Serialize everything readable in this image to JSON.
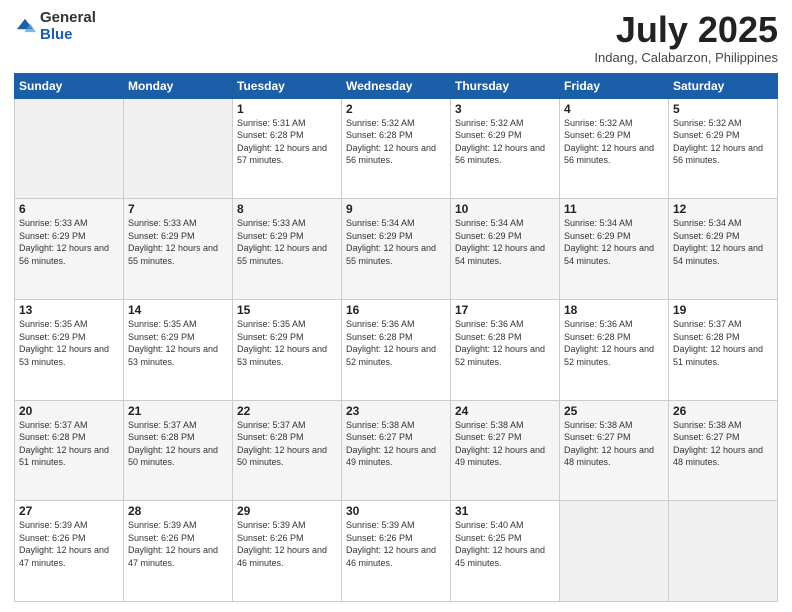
{
  "header": {
    "logo_general": "General",
    "logo_blue": "Blue",
    "month_title": "July 2025",
    "location": "Indang, Calabarzon, Philippines"
  },
  "days_of_week": [
    "Sunday",
    "Monday",
    "Tuesday",
    "Wednesday",
    "Thursday",
    "Friday",
    "Saturday"
  ],
  "weeks": [
    [
      {
        "day": "",
        "empty": true
      },
      {
        "day": "",
        "empty": true
      },
      {
        "day": "1",
        "sunrise": "5:31 AM",
        "sunset": "6:28 PM",
        "daylight": "12 hours and 57 minutes."
      },
      {
        "day": "2",
        "sunrise": "5:32 AM",
        "sunset": "6:28 PM",
        "daylight": "12 hours and 56 minutes."
      },
      {
        "day": "3",
        "sunrise": "5:32 AM",
        "sunset": "6:29 PM",
        "daylight": "12 hours and 56 minutes."
      },
      {
        "day": "4",
        "sunrise": "5:32 AM",
        "sunset": "6:29 PM",
        "daylight": "12 hours and 56 minutes."
      },
      {
        "day": "5",
        "sunrise": "5:32 AM",
        "sunset": "6:29 PM",
        "daylight": "12 hours and 56 minutes."
      }
    ],
    [
      {
        "day": "6",
        "sunrise": "5:33 AM",
        "sunset": "6:29 PM",
        "daylight": "12 hours and 56 minutes."
      },
      {
        "day": "7",
        "sunrise": "5:33 AM",
        "sunset": "6:29 PM",
        "daylight": "12 hours and 55 minutes."
      },
      {
        "day": "8",
        "sunrise": "5:33 AM",
        "sunset": "6:29 PM",
        "daylight": "12 hours and 55 minutes."
      },
      {
        "day": "9",
        "sunrise": "5:34 AM",
        "sunset": "6:29 PM",
        "daylight": "12 hours and 55 minutes."
      },
      {
        "day": "10",
        "sunrise": "5:34 AM",
        "sunset": "6:29 PM",
        "daylight": "12 hours and 54 minutes."
      },
      {
        "day": "11",
        "sunrise": "5:34 AM",
        "sunset": "6:29 PM",
        "daylight": "12 hours and 54 minutes."
      },
      {
        "day": "12",
        "sunrise": "5:34 AM",
        "sunset": "6:29 PM",
        "daylight": "12 hours and 54 minutes."
      }
    ],
    [
      {
        "day": "13",
        "sunrise": "5:35 AM",
        "sunset": "6:29 PM",
        "daylight": "12 hours and 53 minutes."
      },
      {
        "day": "14",
        "sunrise": "5:35 AM",
        "sunset": "6:29 PM",
        "daylight": "12 hours and 53 minutes."
      },
      {
        "day": "15",
        "sunrise": "5:35 AM",
        "sunset": "6:29 PM",
        "daylight": "12 hours and 53 minutes."
      },
      {
        "day": "16",
        "sunrise": "5:36 AM",
        "sunset": "6:28 PM",
        "daylight": "12 hours and 52 minutes."
      },
      {
        "day": "17",
        "sunrise": "5:36 AM",
        "sunset": "6:28 PM",
        "daylight": "12 hours and 52 minutes."
      },
      {
        "day": "18",
        "sunrise": "5:36 AM",
        "sunset": "6:28 PM",
        "daylight": "12 hours and 52 minutes."
      },
      {
        "day": "19",
        "sunrise": "5:37 AM",
        "sunset": "6:28 PM",
        "daylight": "12 hours and 51 minutes."
      }
    ],
    [
      {
        "day": "20",
        "sunrise": "5:37 AM",
        "sunset": "6:28 PM",
        "daylight": "12 hours and 51 minutes."
      },
      {
        "day": "21",
        "sunrise": "5:37 AM",
        "sunset": "6:28 PM",
        "daylight": "12 hours and 50 minutes."
      },
      {
        "day": "22",
        "sunrise": "5:37 AM",
        "sunset": "6:28 PM",
        "daylight": "12 hours and 50 minutes."
      },
      {
        "day": "23",
        "sunrise": "5:38 AM",
        "sunset": "6:27 PM",
        "daylight": "12 hours and 49 minutes."
      },
      {
        "day": "24",
        "sunrise": "5:38 AM",
        "sunset": "6:27 PM",
        "daylight": "12 hours and 49 minutes."
      },
      {
        "day": "25",
        "sunrise": "5:38 AM",
        "sunset": "6:27 PM",
        "daylight": "12 hours and 48 minutes."
      },
      {
        "day": "26",
        "sunrise": "5:38 AM",
        "sunset": "6:27 PM",
        "daylight": "12 hours and 48 minutes."
      }
    ],
    [
      {
        "day": "27",
        "sunrise": "5:39 AM",
        "sunset": "6:26 PM",
        "daylight": "12 hours and 47 minutes."
      },
      {
        "day": "28",
        "sunrise": "5:39 AM",
        "sunset": "6:26 PM",
        "daylight": "12 hours and 47 minutes."
      },
      {
        "day": "29",
        "sunrise": "5:39 AM",
        "sunset": "6:26 PM",
        "daylight": "12 hours and 46 minutes."
      },
      {
        "day": "30",
        "sunrise": "5:39 AM",
        "sunset": "6:26 PM",
        "daylight": "12 hours and 46 minutes."
      },
      {
        "day": "31",
        "sunrise": "5:40 AM",
        "sunset": "6:25 PM",
        "daylight": "12 hours and 45 minutes."
      },
      {
        "day": "",
        "empty": true
      },
      {
        "day": "",
        "empty": true
      }
    ]
  ],
  "labels": {
    "sunrise_prefix": "Sunrise: ",
    "sunset_prefix": "Sunset: ",
    "daylight_prefix": "Daylight: "
  }
}
